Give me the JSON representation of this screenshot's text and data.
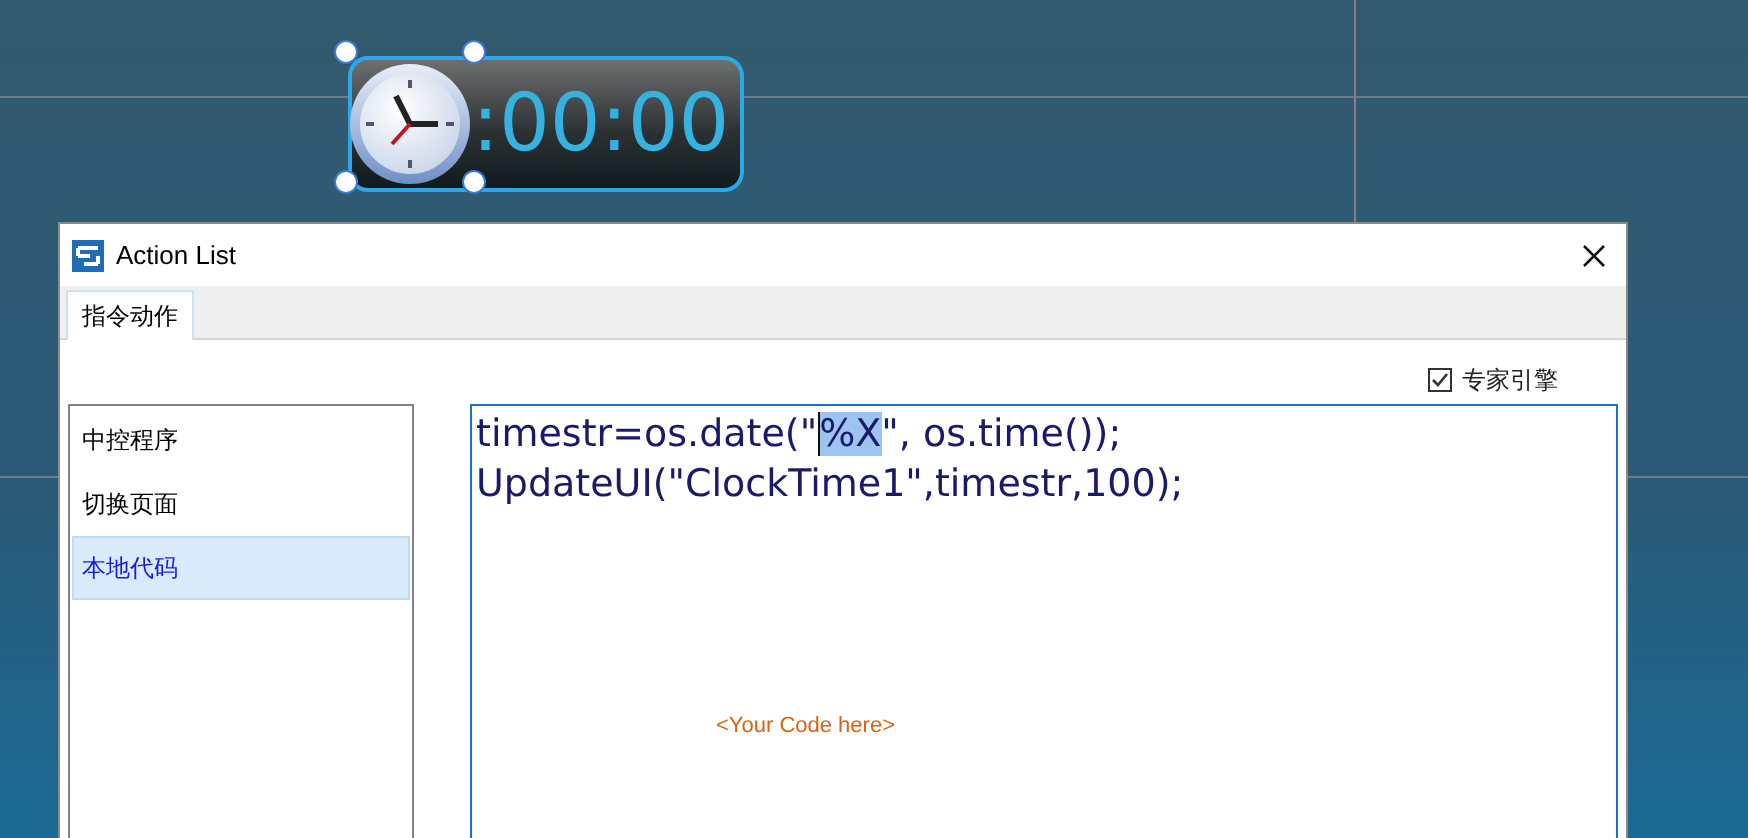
{
  "clock_widget": {
    "time": ":00:00"
  },
  "window": {
    "title": "Action List"
  },
  "tabs": [
    {
      "label": "指令动作",
      "selected": true
    }
  ],
  "expert_engine": {
    "label": "专家引擎",
    "checked": true
  },
  "action_list": [
    {
      "label": "中控程序",
      "selected": false
    },
    {
      "label": "切换页面",
      "selected": false
    },
    {
      "label": "本地代码",
      "selected": true
    }
  ],
  "code_editor": {
    "lines": [
      {
        "before": "timestr=os.date(\"",
        "selection": "%X",
        "after": "\", os.time());"
      },
      {
        "before": "UpdateUI(\"ClockTime1\",timestr,100);"
      }
    ],
    "placeholder": "<Your Code here>"
  }
}
